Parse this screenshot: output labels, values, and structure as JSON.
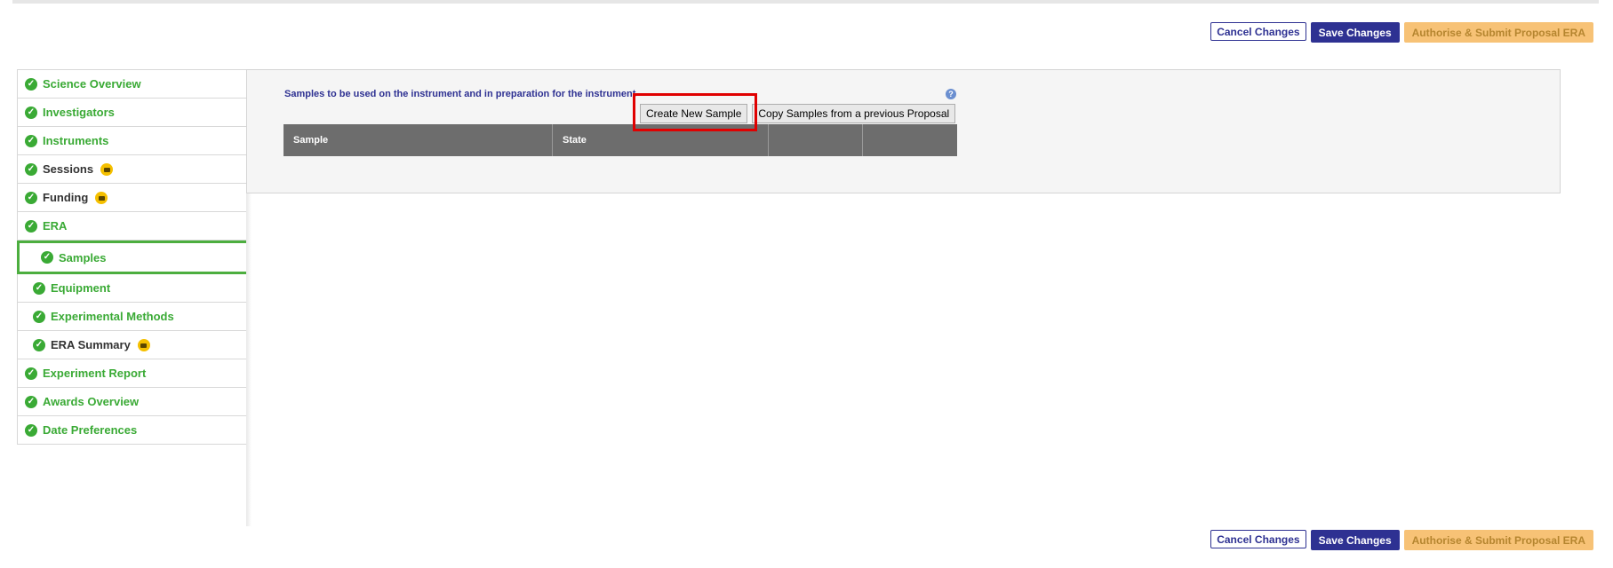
{
  "actions": {
    "cancel_label": "Cancel Changes",
    "save_label": "Save Changes",
    "authorise_label": "Authorise & Submit Proposal ERA"
  },
  "sidebar": {
    "items": [
      {
        "label": "Science Overview",
        "status": "complete"
      },
      {
        "label": "Investigators",
        "status": "complete"
      },
      {
        "label": "Instruments",
        "status": "complete"
      },
      {
        "label": "Sessions",
        "status": "complete",
        "locked": true
      },
      {
        "label": "Funding",
        "status": "complete",
        "locked": true
      },
      {
        "label": "ERA",
        "status": "complete"
      },
      {
        "label": "Samples",
        "status": "complete",
        "active": true
      },
      {
        "label": "Equipment",
        "status": "complete"
      },
      {
        "label": "Experimental Methods",
        "status": "complete"
      },
      {
        "label": "ERA Summary",
        "status": "complete",
        "locked": true
      },
      {
        "label": "Experiment Report",
        "status": "complete"
      },
      {
        "label": "Awards Overview",
        "status": "complete"
      },
      {
        "label": "Date Preferences",
        "status": "complete"
      }
    ]
  },
  "samples": {
    "intro": "Samples to be used on the instrument and in preparation for the instrument",
    "create_label": "Create New Sample",
    "copy_label": "Copy Samples from a previous Proposal",
    "columns": [
      "Sample",
      "State",
      "",
      ""
    ]
  },
  "colors": {
    "brand": "#2e3192",
    "success": "#3aaa35",
    "warning": "#f7c276",
    "highlight": "#e00000"
  }
}
